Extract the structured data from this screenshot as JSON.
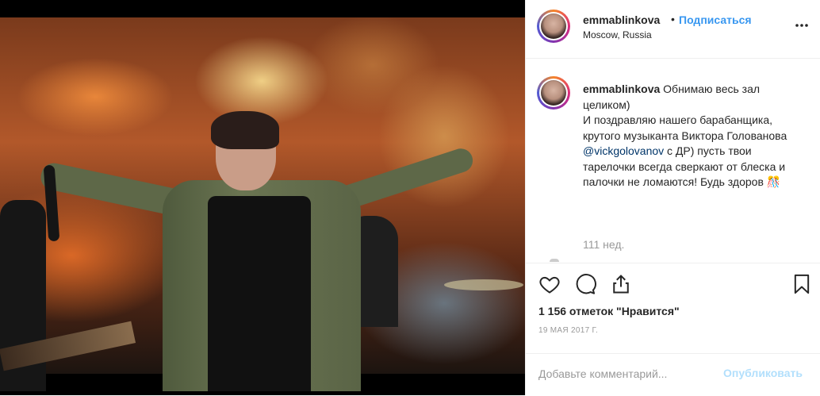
{
  "post": {
    "username": "emmablinkova",
    "separator": "•",
    "follow_label": "Подписаться",
    "location": "Moscow, Russia",
    "more_icon": "more-horizontal-icon"
  },
  "caption": {
    "username": "emmablinkova",
    "text_before_mention": "Обнимаю весь зал целиком)\nИ поздравляю нашего барабанщика, крутого музыканта Виктора Голованова ",
    "mention": "@vickgolovanov",
    "text_after_mention": " с ДР) пусть твои тарелочки всегда сверкают от блеска и палочки не ломаются! Будь здоров 🎊",
    "time": "111 нед."
  },
  "actions": {
    "like_icon": "heart-icon",
    "comment_icon": "comment-icon",
    "share_icon": "share-icon",
    "save_icon": "bookmark-icon",
    "likes_text": "1 156 отметок \"Нравится\"",
    "date": "19 МАЯ 2017 Г."
  },
  "add_comment": {
    "placeholder": "Добавьте комментарий...",
    "post_label": "Опубликовать"
  },
  "colors": {
    "link_blue": "#3897f0",
    "mention_blue": "#003569",
    "post_disabled": "#b2dffc",
    "muted": "#999999"
  }
}
